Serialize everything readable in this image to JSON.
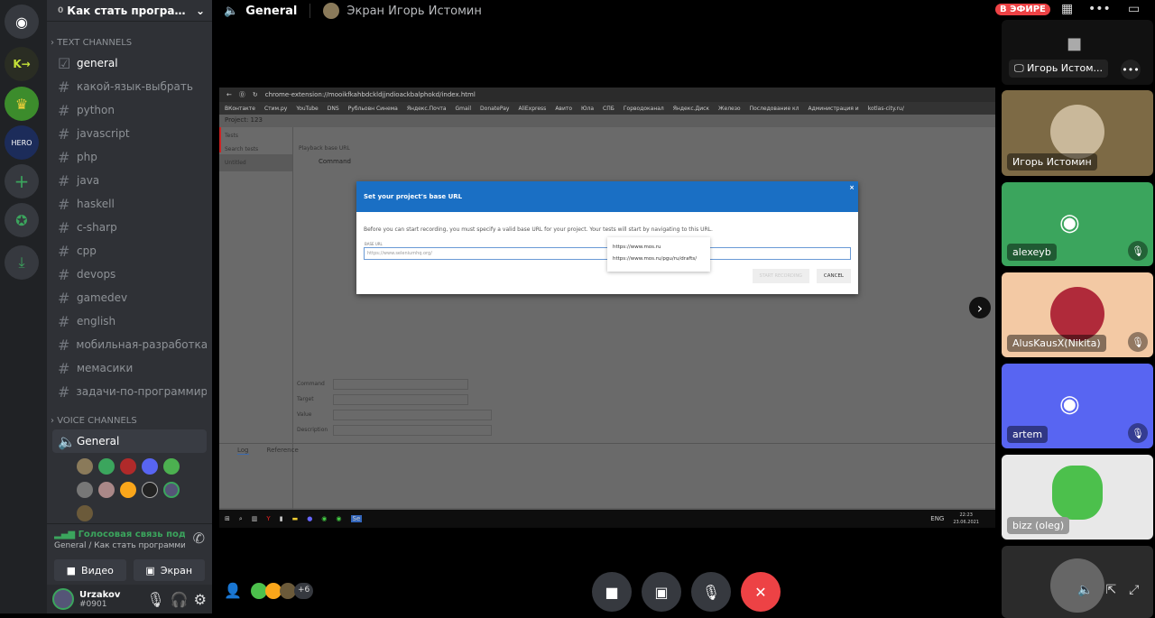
{
  "server": {
    "name": "Как стать программ...",
    "badge": "0"
  },
  "text_category": "TEXT CHANNELS",
  "text_channels": [
    "general",
    "какой-язык-выбрать",
    "python",
    "javascript",
    "php",
    "java",
    "haskell",
    "c-sharp",
    "cpp",
    "devops",
    "gamedev",
    "english",
    "мобильная-разработка",
    "мемасики",
    "задачи-по-программир..."
  ],
  "voice_category": "VOICE CHANNELS",
  "voice_channel": "General",
  "voice_status": {
    "title": "Голосовая связь подключ",
    "subtitle": "General / Как стать программис..."
  },
  "buttons": {
    "video": "Видео",
    "screen": "Экран"
  },
  "user": {
    "name": "Urzakov",
    "tag": "#0901"
  },
  "header": {
    "channel": "General",
    "stream": "Экран Игорь Истомин",
    "live": "В ЭФИРЕ"
  },
  "browser": {
    "url": "chrome-extension://mooikfkahbdckldjjndioackbalphokd/index.html",
    "bookmarks": [
      "ВКонтакте",
      "Стим.ру",
      "YouTube",
      "DNS",
      "Рубльовн Синема",
      "Яндекс.Почта",
      "Gmail",
      "DonatePay",
      "AliExpress",
      "Авито",
      "Юла",
      "СПБ",
      "Горводоканал",
      "Яндекс.Диск",
      "Железо",
      "Последование кл",
      "Администрация и",
      "kotlas-city.ru/"
    ]
  },
  "ide": {
    "project": "Project: 123",
    "tests": "Tests",
    "search_placeholder": "Search tests",
    "untitled": "Untitled",
    "base_url_placeholder": "Playback base URL",
    "command_col": "Command",
    "fields": [
      "Command",
      "Target",
      "Value",
      "Description"
    ],
    "tabs": [
      "Log",
      "Reference"
    ]
  },
  "modal": {
    "title": "Set your project's base URL",
    "text": "Before you can start recording, you must specify a valid base URL for your project. Your tests will start by navigating to this URL.",
    "label": "BASE URL",
    "placeholder": "https://www.seleniumhq.org/",
    "suggestions": [
      "https://www.mos.ru",
      "https://www.mos.ru/pgu/ru/drafts/"
    ],
    "start": "START RECORDING",
    "cancel": "CANCEL"
  },
  "taskbar": {
    "lang": "ENG",
    "time": "22:23",
    "date": "23.06.2021"
  },
  "participants": [
    {
      "name": "Игорь Истом...",
      "kind": "screen"
    },
    {
      "name": "Игорь Истомин",
      "color": "#7d6a45"
    },
    {
      "name": "alexeyb",
      "color": "#3ba55d",
      "muted": true
    },
    {
      "name": "AlusKausX(Nikita)",
      "color": "#f3c9a4",
      "muted": true
    },
    {
      "name": "artem",
      "color": "#5865f2",
      "muted": true
    },
    {
      "name": "bizz (oleg)",
      "color": "#e8e8e8"
    }
  ],
  "extra_count": "+6"
}
